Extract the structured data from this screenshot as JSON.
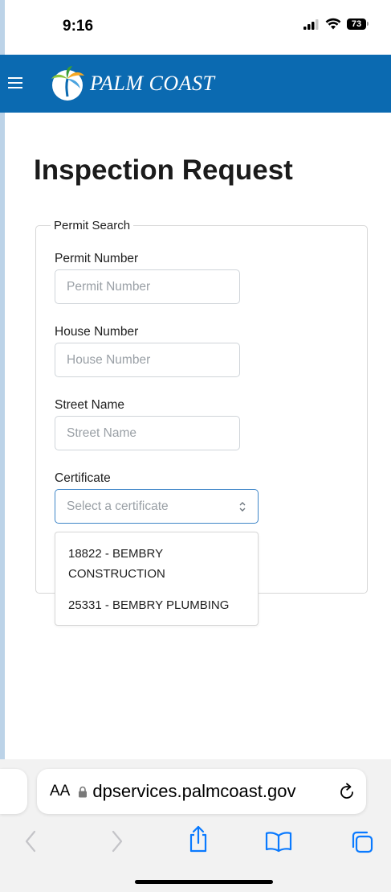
{
  "status_bar": {
    "time": "9:16",
    "battery": "73"
  },
  "header": {
    "logo_text": "PALM COAST",
    "colors": {
      "brand": "#0b6ab1"
    }
  },
  "page": {
    "title": "Inspection Request"
  },
  "permit_search": {
    "legend": "Permit Search",
    "permit_number": {
      "label": "Permit Number",
      "placeholder": "Permit Number",
      "value": ""
    },
    "house_number": {
      "label": "House Number",
      "placeholder": "House Number",
      "value": ""
    },
    "street_name": {
      "label": "Street Name",
      "placeholder": "Street Name",
      "value": ""
    },
    "certificate": {
      "label": "Certificate",
      "placeholder": "Select a certificate",
      "options": [
        {
          "label": "18822 - BEMBRY CONSTRUCTION"
        },
        {
          "label": "25331 - BEMBRY PLUMBING"
        }
      ]
    }
  },
  "browser": {
    "aa_label": "AA",
    "url": "dpservices.palmcoast.gov"
  }
}
